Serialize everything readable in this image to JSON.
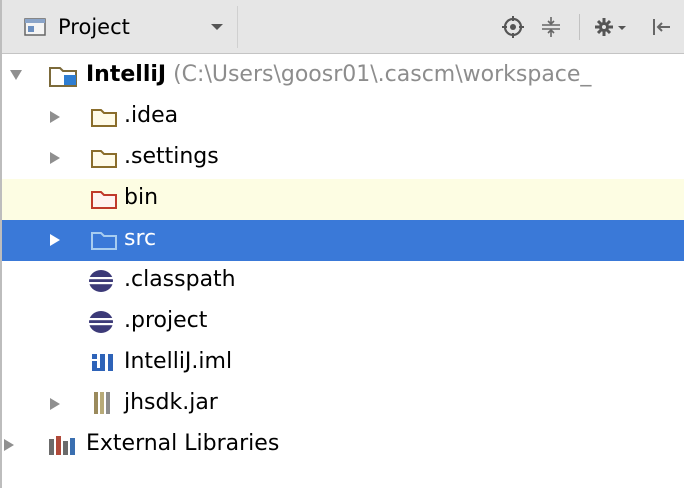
{
  "toolbar": {
    "view_selector": {
      "label": "Project"
    },
    "buttons": [
      {
        "name": "scroll-from-source-icon"
      },
      {
        "name": "collapse-all-icon"
      },
      {
        "name": "settings-gear-icon"
      },
      {
        "name": "hide-panel-icon"
      }
    ]
  },
  "tree": {
    "root": {
      "label": "IntelliJ",
      "path": "(C:\\Users\\goosr01\\.cascm\\workspace_"
    },
    "items": [
      {
        "label": ".idea"
      },
      {
        "label": ".settings"
      },
      {
        "label": "bin"
      },
      {
        "label": "src"
      },
      {
        "label": ".classpath"
      },
      {
        "label": ".project"
      },
      {
        "label": "IntelliJ.iml"
      },
      {
        "label": "jhsdk.jar"
      }
    ],
    "external": {
      "label": "External Libraries"
    }
  },
  "colors": {
    "selection": "#3a79d8",
    "highlight_row": "#fdfde3",
    "folder": "#8a6d2b",
    "excluded_folder": "#c0392b",
    "source_folder": "#6aa6d6",
    "module_folder": "#2e7dd1",
    "eclipse_file": "#3c3a78"
  }
}
